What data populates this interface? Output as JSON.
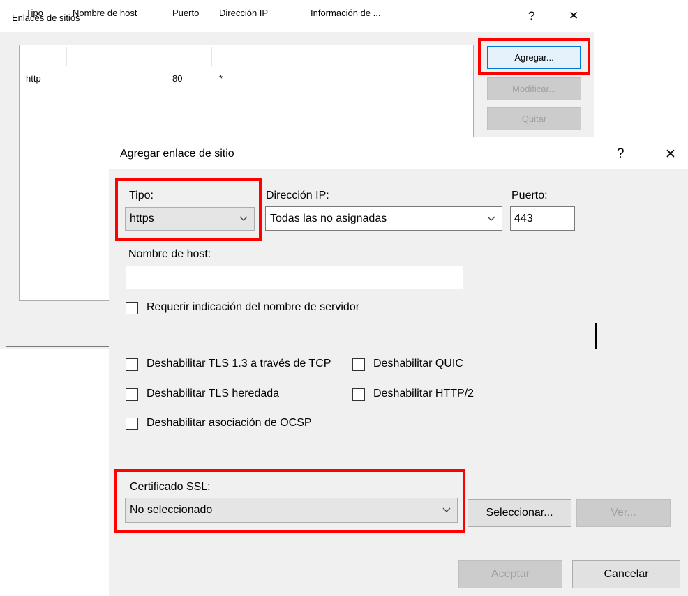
{
  "back_dialog": {
    "title": "Enlaces de sitios",
    "help_label": "?",
    "close_label": "✕",
    "columns": [
      "Tipo",
      "Nombre de host",
      "Puerto",
      "Dirección IP",
      "Información de ..."
    ],
    "rows": [
      {
        "tipo": "http",
        "host": "",
        "puerto": "80",
        "ip": "*",
        "info": ""
      }
    ],
    "buttons": {
      "agregar": "Agregar...",
      "modificar": "Modificar...",
      "quitar": "Quitar"
    }
  },
  "front_dialog": {
    "title": "Agregar enlace de sitio",
    "help_label": "?",
    "close_label": "✕",
    "tipo": {
      "label": "Tipo:",
      "value": "https"
    },
    "ip": {
      "label": "Dirección IP:",
      "value": "Todas las no asignadas"
    },
    "puerto": {
      "label": "Puerto:",
      "value": "443"
    },
    "host": {
      "label": "Nombre de host:",
      "value": ""
    },
    "sni": {
      "label": "Requerir indicación del nombre de servidor",
      "checked": false
    },
    "options": {
      "tls13": "Deshabilitar TLS 1.3 a través de TCP",
      "quic": "Deshabilitar QUIC",
      "legacy_tls": "Deshabilitar TLS heredada",
      "http2": "Deshabilitar HTTP/2",
      "ocsp": "Deshabilitar asociación de OCSP"
    },
    "ssl": {
      "label": "Certificado SSL:",
      "value": "No seleccionado"
    },
    "buttons": {
      "seleccionar": "Seleccionar...",
      "ver": "Ver...",
      "aceptar": "Aceptar",
      "cancelar": "Cancelar"
    }
  },
  "icons": {
    "dropdown": "chevron-down-icon"
  },
  "colors": {
    "highlight": "#ff0000",
    "focus_border": "#0078d7"
  }
}
